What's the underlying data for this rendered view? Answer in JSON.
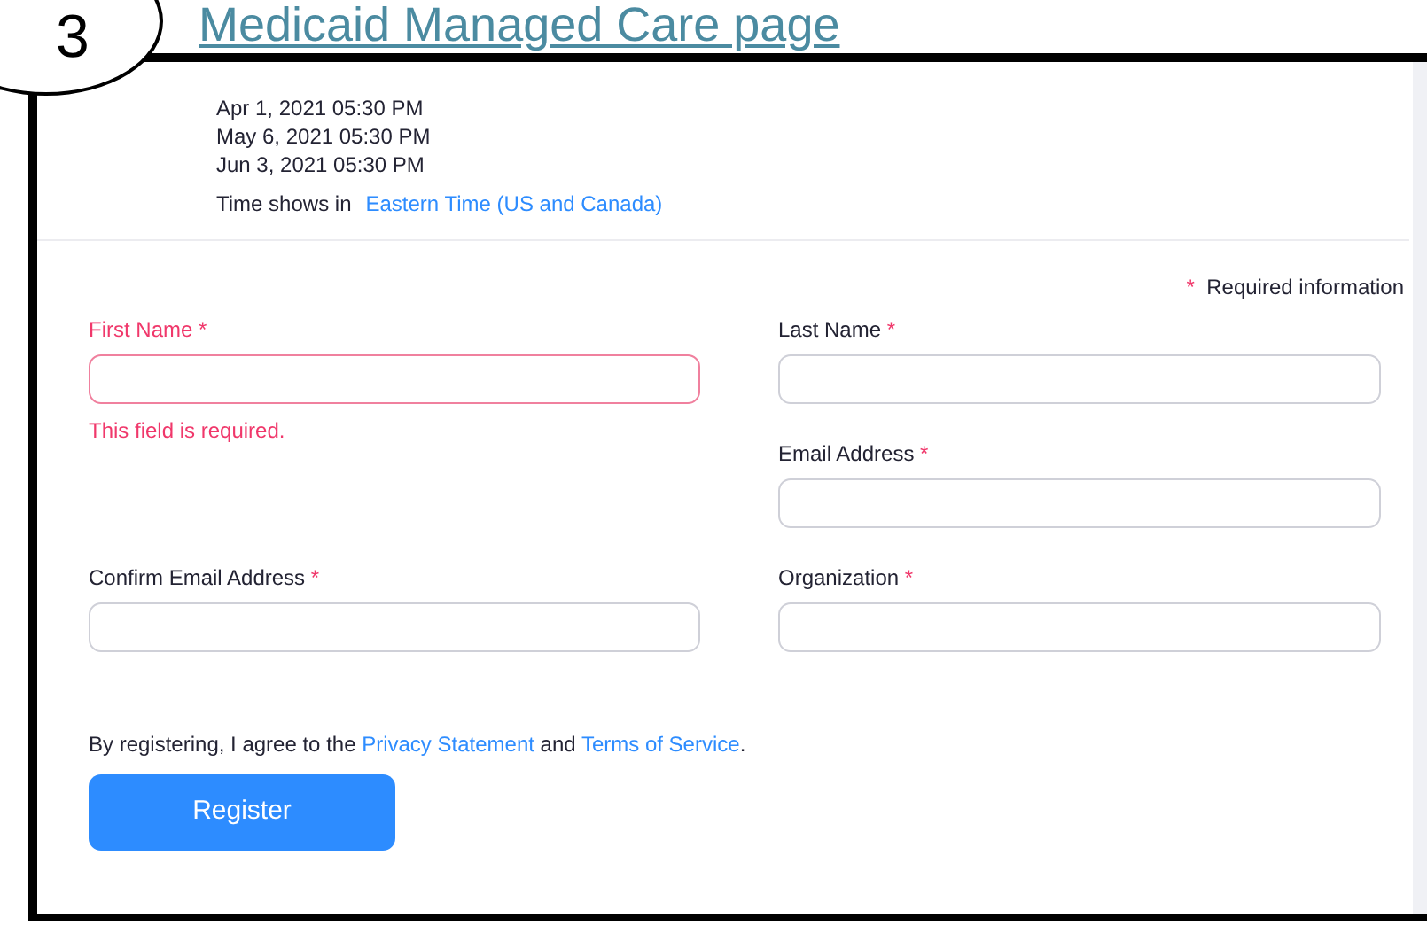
{
  "step_badge": "3",
  "heading_link": "Medicaid Managed Care page",
  "session_times": [
    "Apr 1, 2021 05:30 PM",
    "May 6, 2021 05:30 PM",
    "Jun 3, 2021 05:30 PM"
  ],
  "timezone": {
    "label": "Time shows in",
    "value": "Eastern Time (US and Canada)"
  },
  "required_note": {
    "mark": "*",
    "text": "Required information"
  },
  "fields": [
    {
      "label": "First Name",
      "required_mark": "*",
      "invalid": true,
      "error": "This field is required."
    },
    {
      "label": "Last Name",
      "required_mark": "*",
      "invalid": false
    },
    {
      "label": "Email Address",
      "required_mark": "*",
      "invalid": false
    },
    {
      "label": "Confirm Email Address",
      "required_mark": "*",
      "invalid": false
    },
    {
      "label": "Organization",
      "required_mark": "*",
      "invalid": false
    }
  ],
  "agreement": {
    "before": "By registering, I agree to the",
    "link_1": "Privacy Statement",
    "middle": "and",
    "link_2": "Terms of Service",
    "after": "."
  },
  "register_button": "Register"
}
